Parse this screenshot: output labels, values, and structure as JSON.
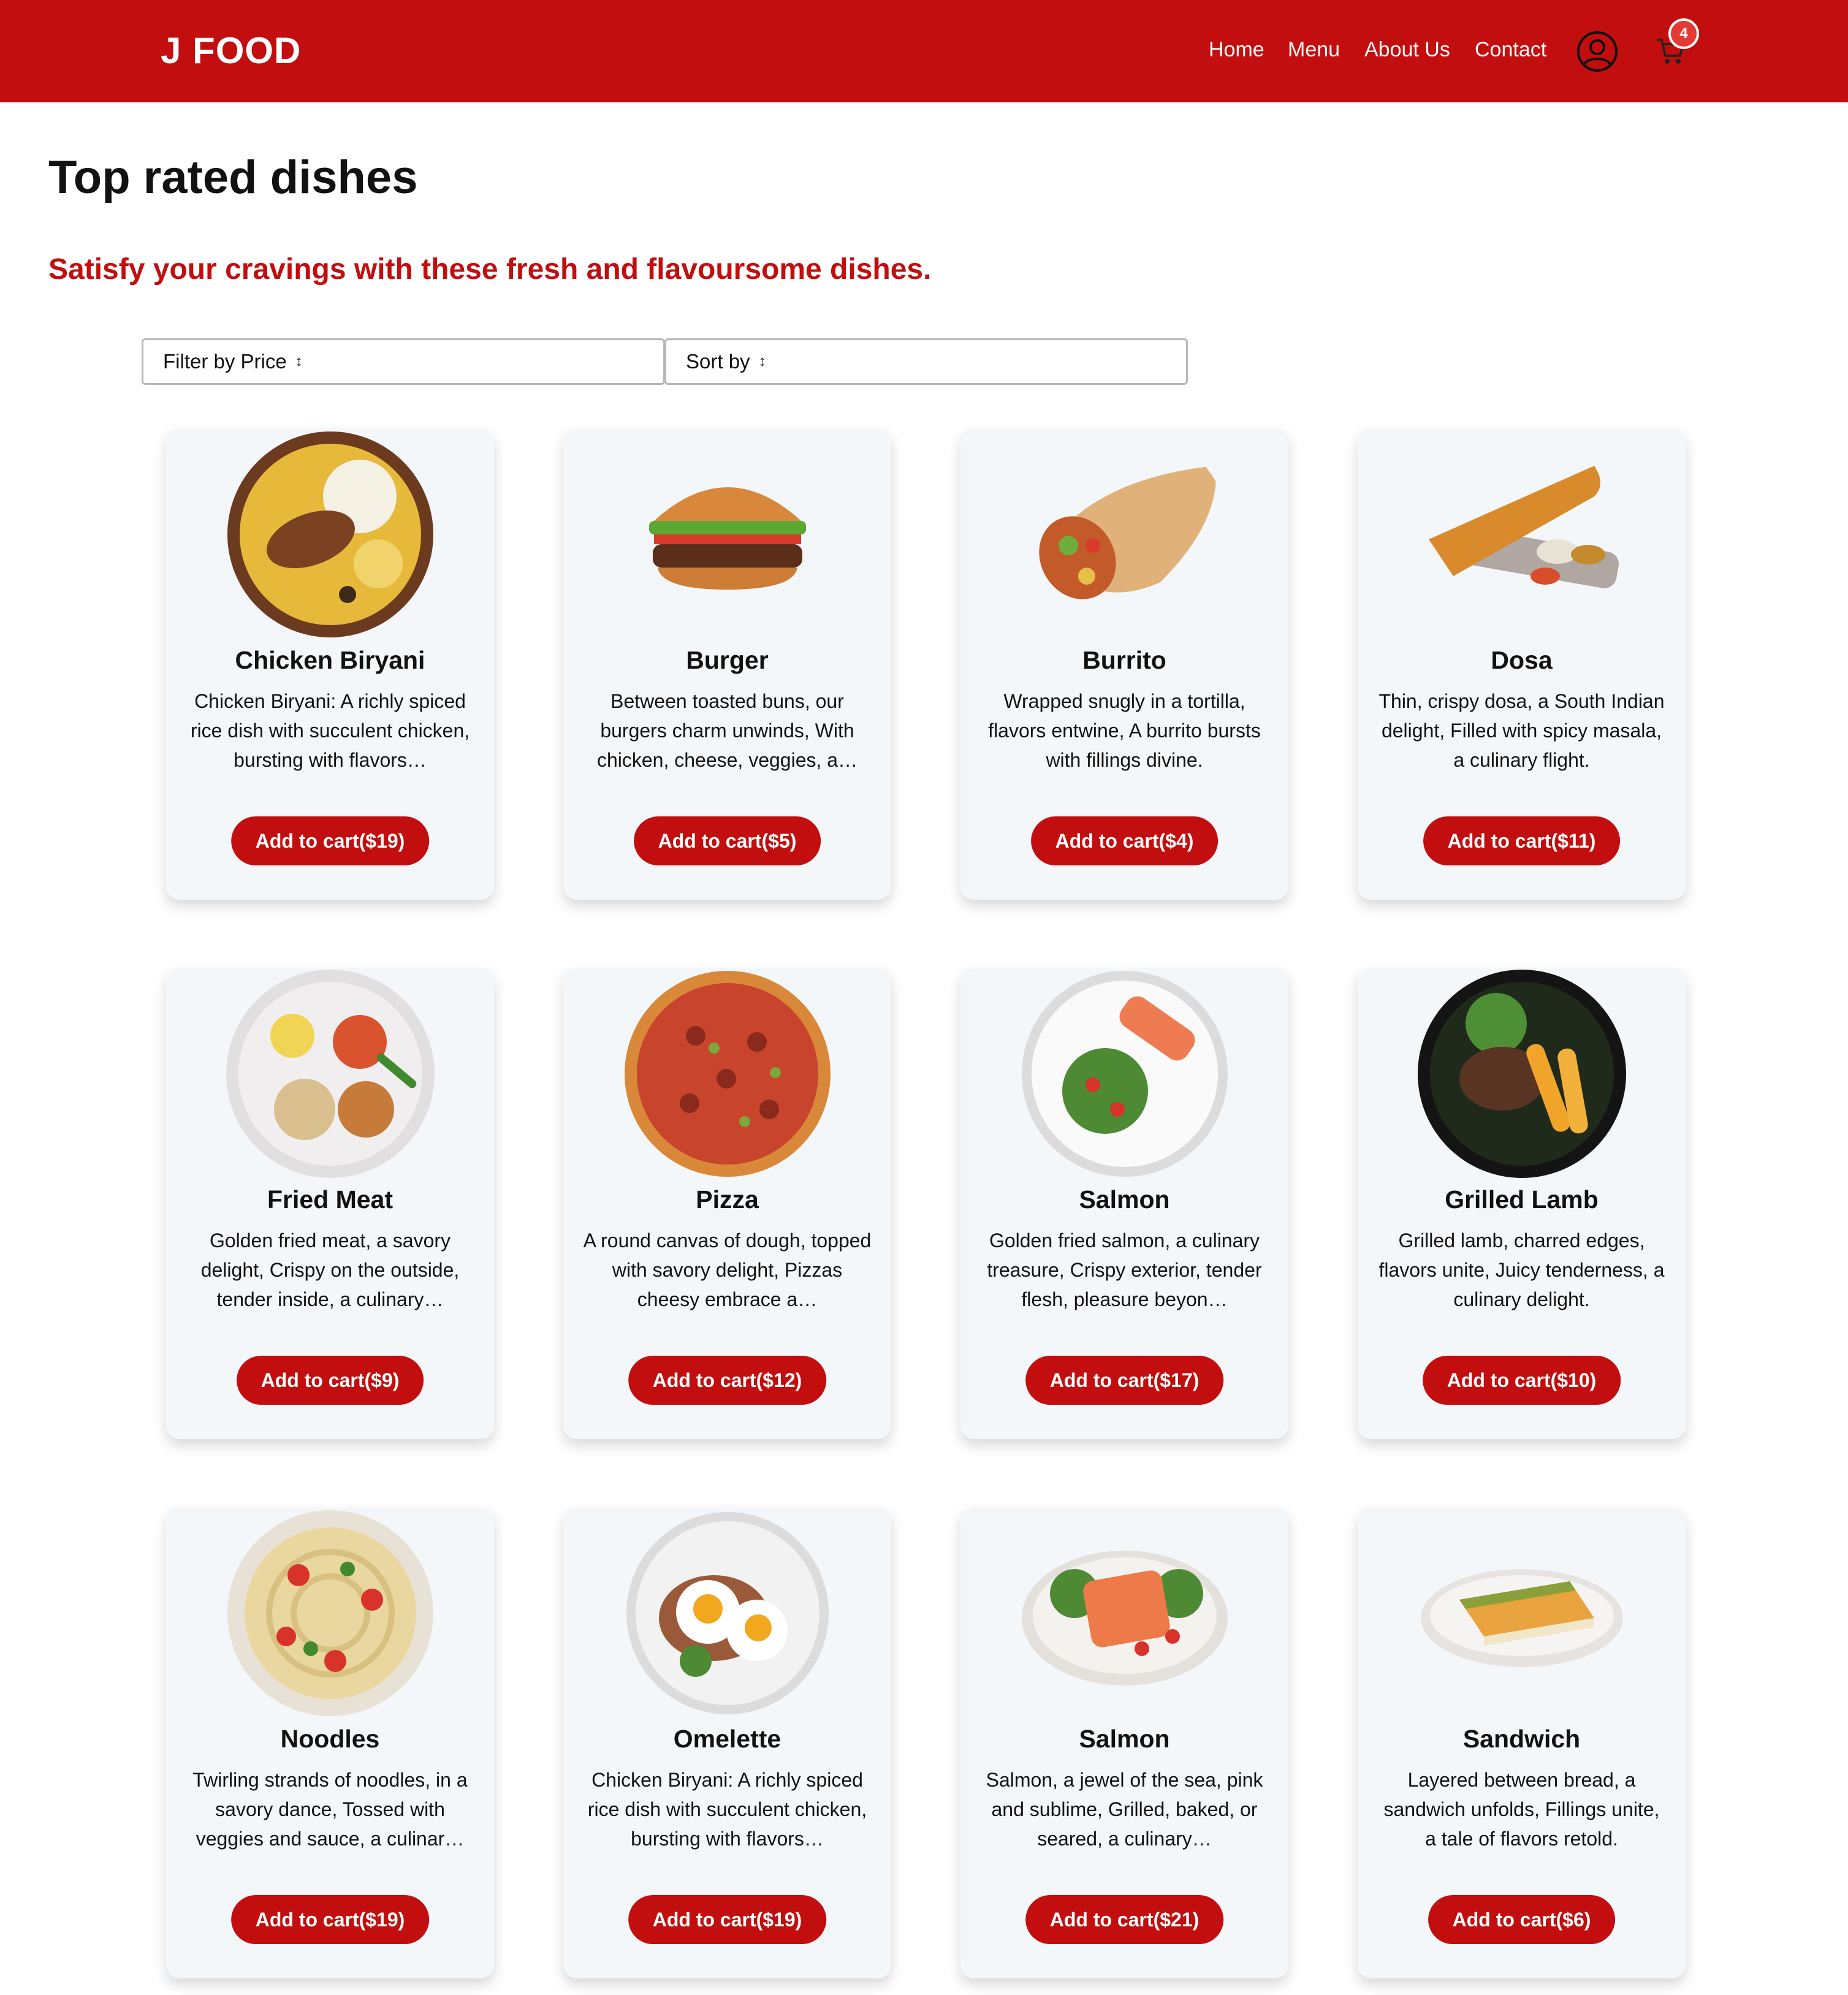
{
  "header": {
    "logo": "J FOOD",
    "nav": [
      "Home",
      "Menu",
      "About Us",
      "Contact"
    ],
    "cart_count": "4",
    "colors": {
      "brand": "#c20e0e",
      "badge": "#e53935"
    },
    "icons": [
      "user-circle-icon",
      "shopping-cart-icon"
    ]
  },
  "page": {
    "title": "Top rated dishes",
    "subtitle": "Satisfy your cravings with these fresh and flavoursome dishes."
  },
  "controls": {
    "filter_label": "Filter by Price",
    "sort_label": "Sort by",
    "arrow_glyph": "↕"
  },
  "dishes": [
    {
      "name": "Chicken Biryani",
      "desc": "Chicken Biryani: A richly spiced rice dish with succulent chicken, bursting with flavors…",
      "button": "Add to cart($19)"
    },
    {
      "name": "Burger",
      "desc": "Between toasted buns, our burgers charm unwinds, With chicken, cheese, veggies, a…",
      "button": "Add to cart($5)"
    },
    {
      "name": "Burrito",
      "desc": "Wrapped snugly in a tortilla, flavors entwine, A burrito bursts with fillings divine.",
      "button": "Add to cart($4)"
    },
    {
      "name": "Dosa",
      "desc": "Thin, crispy dosa, a South Indian delight, Filled with spicy masala, a culinary flight.",
      "button": "Add to cart($11)"
    },
    {
      "name": "Fried Meat",
      "desc": "Golden fried meat, a savory delight, Crispy on the outside, tender inside, a culinary…",
      "button": "Add to cart($9)"
    },
    {
      "name": "Pizza",
      "desc": "A round canvas of dough, topped with savory delight, Pizzas cheesy embrace a…",
      "button": "Add to cart($12)"
    },
    {
      "name": "Salmon",
      "desc": "Golden fried salmon, a culinary treasure, Crispy exterior, tender flesh, pleasure beyon…",
      "button": "Add to cart($17)"
    },
    {
      "name": "Grilled Lamb",
      "desc": "Grilled lamb, charred edges, flavors unite, Juicy tenderness, a culinary delight.",
      "button": "Add to cart($10)"
    },
    {
      "name": "Noodles",
      "desc": "Twirling strands of noodles, in a savory dance, Tossed with veggies and sauce, a culinar…",
      "button": "Add to cart($19)"
    },
    {
      "name": "Omelette",
      "desc": "Chicken Biryani: A richly spiced rice dish with succulent chicken, bursting with flavors…",
      "button": "Add to cart($19)"
    },
    {
      "name": "Salmon",
      "desc": "Salmon, a jewel of the sea, pink and sublime, Grilled, baked, or seared, a culinary…",
      "button": "Add to cart($21)"
    },
    {
      "name": "Sandwich",
      "desc": "Layered between bread, a sandwich unfolds, Fillings unite, a tale of flavors retold.",
      "button": "Add to cart($6)"
    }
  ]
}
